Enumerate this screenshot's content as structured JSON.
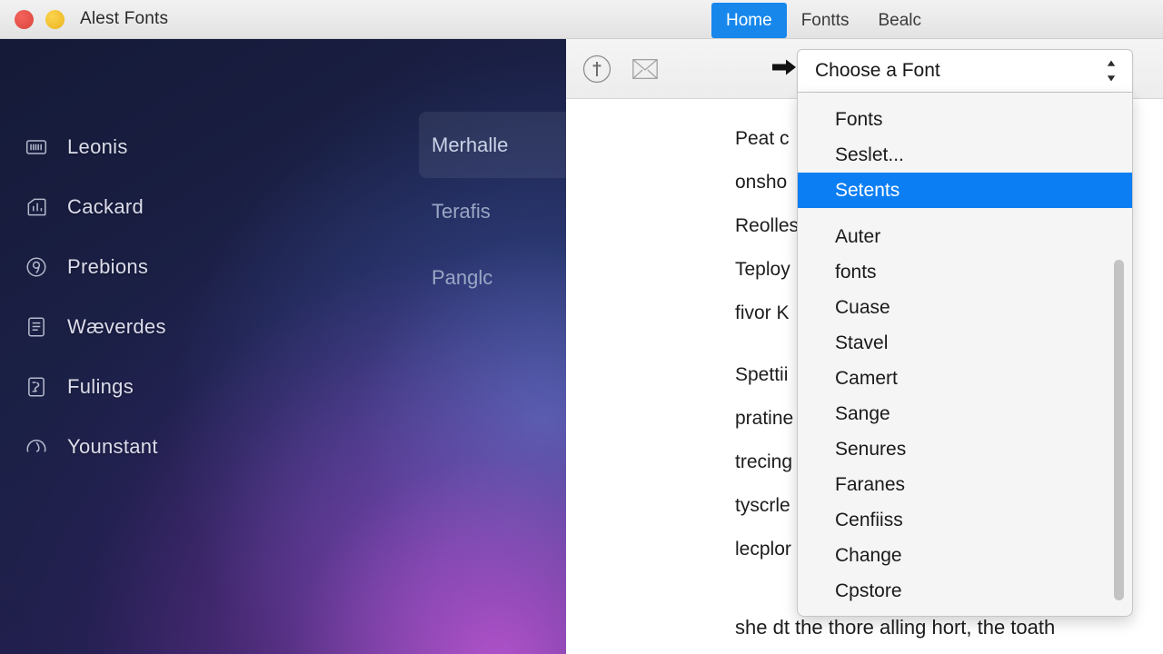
{
  "window": {
    "title": "Alest Fonts",
    "traffic_lights": [
      {
        "name": "close-button",
        "color": "#e24e46"
      },
      {
        "name": "minimize-button",
        "color": "#f1bd2c"
      }
    ]
  },
  "tabs": [
    {
      "label": "Home",
      "active": true
    },
    {
      "label": "Fontts",
      "active": false
    },
    {
      "label": "Bealc",
      "active": false
    }
  ],
  "sidebar": {
    "accent_start": "#151a38",
    "accent_end": "#2a2258",
    "items": [
      {
        "label": "Leonis",
        "icon": "barcode-icon"
      },
      {
        "label": "Cackard",
        "icon": "bar-chart-icon"
      },
      {
        "label": "Prebions",
        "icon": "circled-nine-icon"
      },
      {
        "label": "Wæverdes",
        "icon": "document-lines-icon"
      },
      {
        "label": "Fulings",
        "icon": "document-note-icon"
      },
      {
        "label": "Younstant",
        "icon": "gauge-icon"
      }
    ],
    "subitems": [
      {
        "label": "Merhalle",
        "selected": true
      },
      {
        "label": "Terafis",
        "selected": false
      },
      {
        "label": "Panglc",
        "selected": false
      }
    ]
  },
  "toolbar": {
    "buttons": [
      {
        "name": "dagger-circle-icon",
        "glyph": "†"
      },
      {
        "name": "envelope-x-icon",
        "glyph": "⌧"
      }
    ],
    "arrow": {
      "name": "arrow-right-icon",
      "glyph": "➡"
    }
  },
  "document": {
    "lines": [
      "Peat c",
      "onsho",
      "Reolles",
      "Teploy",
      "fivor K",
      "Spettii",
      "pratine",
      "trecing",
      "tyscrle",
      "lecplor"
    ],
    "bottom_line": "she dt the thore alling hort, the toath"
  },
  "dropdown": {
    "combo_label": "Choose a Font",
    "stepper_icon": "chevron-up-down-icon",
    "items": [
      {
        "label": "Fonts",
        "highlight": false
      },
      {
        "label": "Seslet...",
        "highlight": false
      },
      {
        "label": "Setents",
        "highlight": true
      },
      {
        "label": "Auter",
        "highlight": false
      },
      {
        "label": "fonts",
        "highlight": false
      },
      {
        "label": "Cuase",
        "highlight": false
      },
      {
        "label": "Stavel",
        "highlight": false
      },
      {
        "label": "Camert",
        "highlight": false
      },
      {
        "label": "Sange",
        "highlight": false
      },
      {
        "label": "Senures",
        "highlight": false
      },
      {
        "label": "Faranes",
        "highlight": false
      },
      {
        "label": "Cenfiiss",
        "highlight": false
      },
      {
        "label": "Change",
        "highlight": false
      },
      {
        "label": "Cpstore",
        "highlight": false
      }
    ],
    "highlight_color": "#0b7ef4"
  }
}
